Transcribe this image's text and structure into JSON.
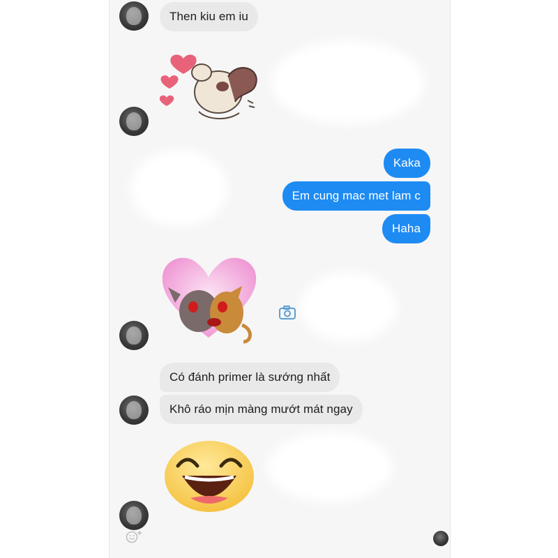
{
  "messages": {
    "m1": "Then kiu em iu",
    "m2": "Kaka",
    "m3": "Em cung mac met lam c",
    "m4": "Haha",
    "m5": "Có đánh primer là sướng nhất",
    "m6": "Khô ráo mịn màng mướt mát ngay"
  },
  "icons": {
    "camera": "camera-icon",
    "react": "emoji-add-reaction-icon",
    "avatar": "contact-avatar"
  },
  "colors": {
    "outgoing_bubble": "#1e8bf3",
    "incoming_bubble": "#e9e9ea",
    "background": "#f6f6f6"
  }
}
